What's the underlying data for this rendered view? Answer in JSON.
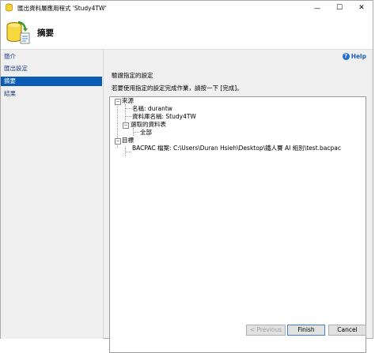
{
  "window": {
    "title": "匯出資料層應用程式 'Study4TW'",
    "controls": {
      "minimize": "—",
      "maximize": "☐",
      "close": "✕"
    }
  },
  "header": {
    "page_title": "摘要"
  },
  "sidebar": {
    "items": [
      {
        "label": "簡介",
        "active": false
      },
      {
        "label": "匯出設定",
        "active": false
      },
      {
        "label": "摘要",
        "active": true
      },
      {
        "label": "結果",
        "active": false
      }
    ]
  },
  "content": {
    "help_label": "Help",
    "section_title": "驗證指定的設定",
    "description": "若要使用指定的設定完成作業，請按一下 [完成]。",
    "tree": {
      "source": "來源",
      "name": "名稱: durantw",
      "db_name": "資料庫名稱: Study4TW",
      "selected_tables": "選取的資料表",
      "all": "全部",
      "target": "目標",
      "bacpac": "BACPAC 檔案: C:\\Users\\Duran Hsieh\\Desktop\\鐵人賽 AI 組別\\test.bacpac"
    }
  },
  "buttons": {
    "previous": "< Previous",
    "finish": "Finish",
    "cancel": "Cancel"
  },
  "colors": {
    "accent": "#0a5bb4",
    "link": "#1f3f86"
  }
}
